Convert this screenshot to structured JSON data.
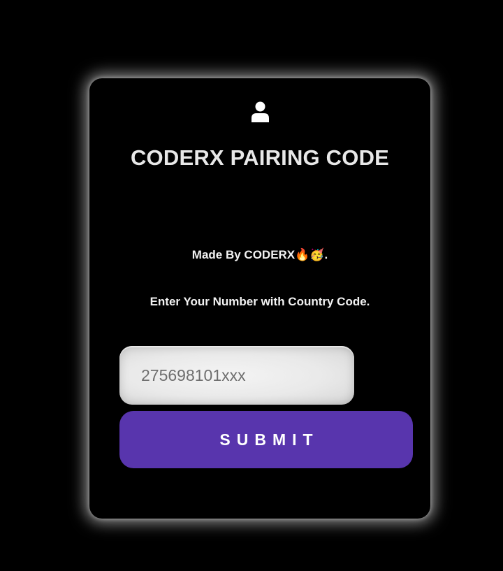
{
  "card": {
    "title": "CODERX PAIRING CODE",
    "made_by": "Made By CODERX🔥🥳.",
    "instruction": "Enter Your Number with Country Code."
  },
  "form": {
    "phone_placeholder": "275698101xxx",
    "phone_value": "",
    "submit_label": "SUBMIT"
  },
  "icons": {
    "header": "user-icon"
  },
  "colors": {
    "background": "#000000",
    "card_glow": "#ffffff",
    "submit_button": "#5835ad",
    "title_text": "#e8e8e8",
    "input_background": "#ececec"
  }
}
